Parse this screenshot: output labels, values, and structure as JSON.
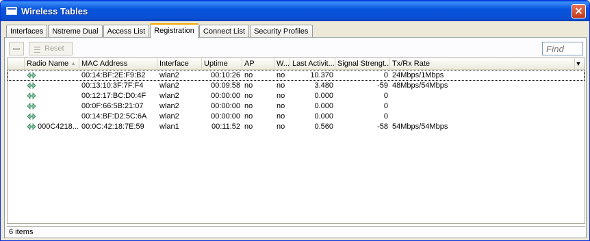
{
  "window": {
    "title": "Wireless Tables",
    "close_glyph": "✕"
  },
  "tabs": [
    {
      "label": "Interfaces",
      "active": false
    },
    {
      "label": "Nstreme Dual",
      "active": false
    },
    {
      "label": "Access List",
      "active": false
    },
    {
      "label": "Registration",
      "active": true
    },
    {
      "label": "Connect List",
      "active": false
    },
    {
      "label": "Security Profiles",
      "active": false
    }
  ],
  "toolbar": {
    "reset_label": "Reset",
    "find_placeholder": "Find"
  },
  "table": {
    "columns": [
      {
        "label": "Radio Name",
        "sort": "▲"
      },
      {
        "label": "MAC Address"
      },
      {
        "label": "Interface"
      },
      {
        "label": "Uptime"
      },
      {
        "label": "AP"
      },
      {
        "label": "W..."
      },
      {
        "label": "Last Activit..."
      },
      {
        "label": "Signal Strengt..."
      },
      {
        "label": "Tx/Rx Rate"
      }
    ],
    "menu_glyph": "▼",
    "rows": [
      {
        "radio_name": "",
        "mac": "00:14:BF:2E:F9:B2",
        "interface": "wlan2",
        "uptime": "00:10:26",
        "ap": "no",
        "w": "no",
        "last_activity": "10.370",
        "signal": "0",
        "rate": "24Mbps/1Mbps"
      },
      {
        "radio_name": "",
        "mac": "00:13:10:3F:7F:F4",
        "interface": "wlan2",
        "uptime": "00:09:58",
        "ap": "no",
        "w": "no",
        "last_activity": "3.480",
        "signal": "-59",
        "rate": "48Mbps/54Mbps"
      },
      {
        "radio_name": "",
        "mac": "00:12:17:BC:D0:4F",
        "interface": "wlan2",
        "uptime": "00:00:00",
        "ap": "no",
        "w": "no",
        "last_activity": "0.000",
        "signal": "0",
        "rate": ""
      },
      {
        "radio_name": "",
        "mac": "00:0F:66:5B:21:07",
        "interface": "wlan2",
        "uptime": "00:00:00",
        "ap": "no",
        "w": "no",
        "last_activity": "0.000",
        "signal": "0",
        "rate": ""
      },
      {
        "radio_name": "",
        "mac": "00:14:BF:D2:5C:6A",
        "interface": "wlan2",
        "uptime": "00:00:00",
        "ap": "no",
        "w": "no",
        "last_activity": "0.000",
        "signal": "0",
        "rate": ""
      },
      {
        "radio_name": "000C4218...",
        "mac": "00:0C:42:18:7E:59",
        "interface": "wlan1",
        "uptime": "00:11:52",
        "ap": "no",
        "w": "no",
        "last_activity": "0.560",
        "signal": "-58",
        "rate": "54Mbps/54Mbps"
      }
    ]
  },
  "status": {
    "text": "6 items"
  },
  "colors": {
    "titlebar": "#0855dd",
    "tab_active_accent": "#f5a800",
    "radio_icon": "#2b7a4f"
  },
  "icons": {
    "row_icon": "radio-link-icon",
    "window_icon": "window-icon"
  }
}
